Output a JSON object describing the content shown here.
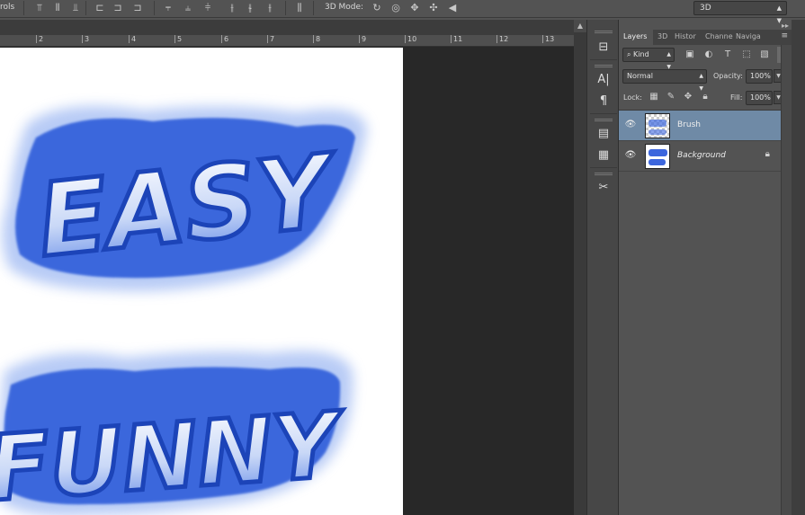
{
  "options_bar": {
    "left_fragment": "rols",
    "mode_label": "3D Mode:",
    "workspace_value": "3D",
    "icons": [
      "align-top-icon",
      "align-vcenter-icon",
      "align-bottom-icon",
      "align-left-icon",
      "align-hcenter-icon",
      "align-right-icon",
      "distribute-top-icon",
      "distribute-vcenter-icon",
      "distribute-bottom-icon",
      "distribute-left-icon",
      "distribute-hcenter-icon",
      "distribute-right-icon",
      "auto-align-icon",
      "orbit-3d-icon",
      "roll-3d-icon",
      "pan-3d-icon",
      "slide-3d-icon",
      "scale-3d-icon"
    ]
  },
  "ruler": {
    "ticks": [
      "2",
      "3",
      "4",
      "5",
      "6",
      "7",
      "8",
      "9",
      "10",
      "11",
      "12",
      "13"
    ]
  },
  "canvas": {
    "words": [
      "EASY",
      "FUNNY"
    ],
    "accent": "#1f4fd6",
    "glow": "#8fb0f0"
  },
  "dock": {
    "icons": [
      "history-icon",
      "character-icon",
      "paragraph-icon",
      "properties-icon",
      "notes-icon",
      "tools-preset-icon"
    ]
  },
  "layers_panel": {
    "tabs": [
      "Layers",
      "3D",
      "Histor",
      "Channe",
      "Naviga"
    ],
    "active_tab": "Layers",
    "filter_value": "Kind",
    "filter_icons": [
      "pixel-filter-icon",
      "adjustment-filter-icon",
      "type-filter-icon",
      "shape-filter-icon",
      "smart-object-filter-icon"
    ],
    "blend_mode": "Normal",
    "opacity_label": "Opacity:",
    "opacity_value": "100%",
    "lock_label": "Lock:",
    "fill_label": "Fill:",
    "fill_value": "100%",
    "layers": [
      {
        "name": "Brush",
        "selected": true,
        "visible": true,
        "locked": false
      },
      {
        "name": "Background",
        "selected": false,
        "visible": true,
        "locked": true
      }
    ]
  }
}
